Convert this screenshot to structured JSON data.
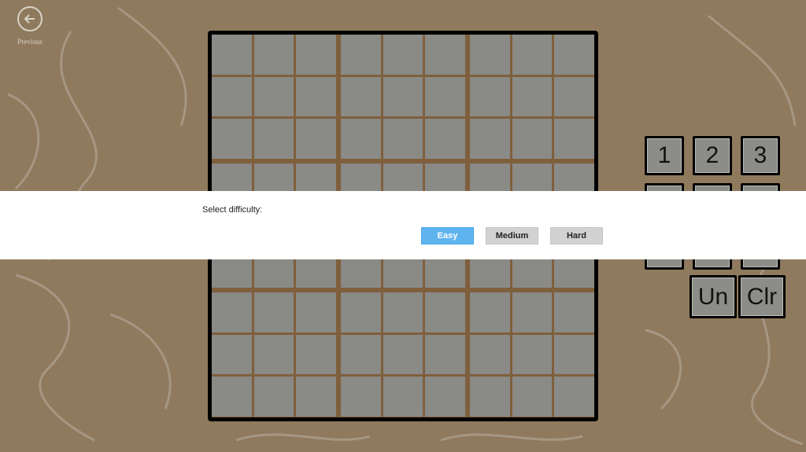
{
  "nav": {
    "back_label": "Previous"
  },
  "board": {
    "rows": 9,
    "cols": 9
  },
  "pad": {
    "keys": [
      "1",
      "2",
      "3",
      "",
      "",
      "",
      "",
      "",
      "",
      "Un",
      "Clr"
    ]
  },
  "dialog": {
    "title": "Select difficulty:",
    "buttons": [
      "Easy",
      "Medium",
      "Hard"
    ],
    "selected": "Easy"
  },
  "colors": {
    "background": "#8f7a5e",
    "board_lines": "#7f5f3c",
    "cell": "#8a8a87",
    "accent": "#5fb4ef"
  }
}
